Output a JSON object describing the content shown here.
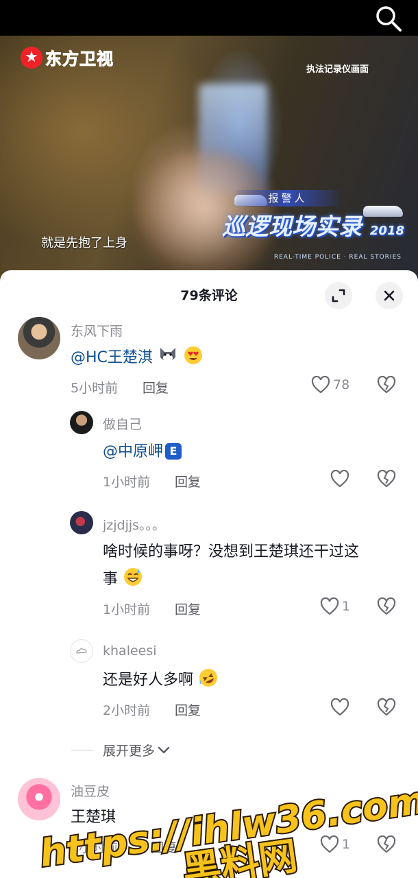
{
  "video": {
    "logo_text": "东方卫视",
    "cam_label": "执法记录仪画面",
    "caller_label": "报警人",
    "show_title": "巡逻现场实录",
    "show_year": "2018",
    "show_sub": "REAL-TIME POLICE · REAL STORIES",
    "subtitle": "就是先抱了上身"
  },
  "sheet": {
    "title": "79条评论"
  },
  "comments": [
    {
      "user": "东风下雨",
      "mention": "@HC王楚淇",
      "time": "5小时前",
      "reply": "回复",
      "likes": "78"
    },
    {
      "user": "做自己",
      "mention": "@中原岬",
      "badge": "E",
      "time": "1小时前",
      "reply": "回复",
      "likes": ""
    },
    {
      "user": "jzjdjjs。。。",
      "text_line1": "啥时候的事呀？没想到王楚琪还干过这",
      "text_line2": "事",
      "time": "1小时前",
      "reply": "回复",
      "likes": "1"
    },
    {
      "user": "khaleesi",
      "text": "还是好人多啊",
      "time": "2小时前",
      "reply": "回复",
      "likes": ""
    },
    {
      "user": "油豆皮",
      "text": "王楚琪",
      "time": "1小时前",
      "reply": "回复",
      "likes": "1"
    }
  ],
  "expand_more": "展开更多",
  "watermark": {
    "line1": "https://ihlw36.com",
    "line2": "黑料网"
  },
  "colors": {
    "mention": "#0e4f92",
    "meta": "#8a8b91",
    "watermark_fill": "#f6c21c",
    "brand_red": "#e8242a"
  }
}
